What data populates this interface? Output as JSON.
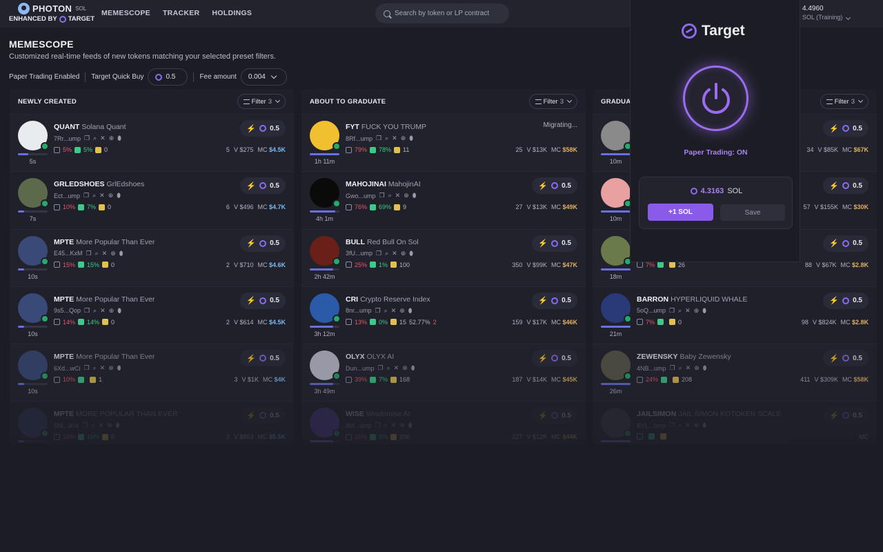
{
  "brand": {
    "name": "PHOTON",
    "chain": "SOL",
    "enhanced": "ENHANCED BY",
    "partner": "TARGET"
  },
  "nav": {
    "memescope": "MEMESCOPE",
    "tracker": "TRACKER",
    "holdings": "HOLDINGS"
  },
  "search": {
    "placeholder": "Search by token or LP contract"
  },
  "account": {
    "balance": "4.4960",
    "label": "SOL (Training)"
  },
  "page": {
    "title": "MEMESCOPE",
    "subtitle": "Customized real-time feeds of new tokens matching your selected preset filters."
  },
  "options": {
    "paper": "Paper Trading Enabled",
    "quickbuy_label": "Target Quick Buy",
    "quickbuy_value": "0.5",
    "fee_label": "Fee amount",
    "fee_value": "0.004"
  },
  "colors": {
    "accent": "#8b6cf0",
    "red": "#e05a6a",
    "green": "#3ec98a",
    "yellow": "#e0c050"
  },
  "columns": [
    {
      "title": "NEWLY CREATED",
      "filter": "Filter",
      "filter_count": "3",
      "cards": [
        {
          "ticker": "QUANT",
          "name": "Solana Quant",
          "addr": "7Rr...ump",
          "age": "5s",
          "s1": "5%",
          "s2": "5%",
          "s3": "0",
          "holders": "5",
          "vol": "V $275",
          "mc": "$4.5K",
          "buy": "0.5",
          "progress": 0.35,
          "av": "#e8ecef"
        },
        {
          "ticker": "GRLEDSHOES",
          "name": "GrlEdshoes",
          "addr": "Ect...ump",
          "age": "7s",
          "s1": "10%",
          "s2": "7%",
          "s3": "0",
          "holders": "6",
          "vol": "V $496",
          "mc": "$4.7K",
          "buy": "0.5",
          "progress": 0.2,
          "av": "#5a6a4a"
        },
        {
          "ticker": "MPTE",
          "name": "More Popular Than Ever",
          "addr": "E45...KxM",
          "age": "10s",
          "s1": "15%",
          "s2": "15%",
          "s3": "0",
          "holders": "2",
          "vol": "V $710",
          "mc": "$4.6K",
          "buy": "0.5",
          "progress": 0.2,
          "av": "#3a4a78"
        },
        {
          "ticker": "MPTE",
          "name": "More Popular Than Ever",
          "addr": "9s5...Qop",
          "age": "10s",
          "s1": "14%",
          "s2": "14%",
          "s3": "0",
          "holders": "2",
          "vol": "V $614",
          "mc": "$4.5K",
          "buy": "0.5",
          "progress": 0.2,
          "av": "#3a4a78"
        },
        {
          "ticker": "MPTE",
          "name": "More Popular Than Ever",
          "addr": "6Xd...wCi",
          "age": "10s",
          "s1": "10%",
          "s2": "",
          "s3": "1",
          "holders": "3",
          "vol": "V $1K",
          "mc": "$4K",
          "buy": "0.5",
          "progress": 0.2,
          "av": "#3a4a78"
        },
        {
          "ticker": "MPTE",
          "name": "MORE POPULAR THAN EVER",
          "addr": "5Ni...iKrk",
          "age": "",
          "s1": "16%",
          "s2": "16%",
          "s3": "0",
          "holders": "2",
          "vol": "V $863",
          "mc": "$5.5K",
          "buy": "0.5",
          "progress": 0.2,
          "av": "#3a4a78"
        }
      ]
    },
    {
      "title": "ABOUT TO GRADUATE",
      "filter": "Filter",
      "filter_count": "3",
      "cards": [
        {
          "ticker": "FYT",
          "name": "FUCK YOU TRUMP",
          "addr": "8Rf...ump",
          "age": "1h 11m",
          "s1": "79%",
          "s2": "78%",
          "s3": "11",
          "holders": "25",
          "vol": "V $13K",
          "mc": "$58K",
          "buy": "",
          "status": "Migrating...",
          "progress": 1,
          "av": "#f0c030"
        },
        {
          "ticker": "MAHOJINAI",
          "name": "MahojinAI",
          "addr": "Gwo...ump",
          "age": "4h 1m",
          "s1": "76%",
          "s2": "69%",
          "s3": "9",
          "holders": "27",
          "vol": "V $13K",
          "mc": "$49K",
          "buy": "0.5",
          "progress": 0.85,
          "av": "#0a0a0a"
        },
        {
          "ticker": "BULL",
          "name": "Red Bull On Sol",
          "addr": "3fU...ump",
          "age": "2h 42m",
          "s1": "25%",
          "s2": "1%",
          "s3": "100",
          "holders": "350",
          "vol": "V $99K",
          "mc": "$47K",
          "buy": "0.5",
          "progress": 0.8,
          "av": "#6a2018"
        },
        {
          "ticker": "CRI",
          "name": "Crypto Reserve Index",
          "addr": "8nr...ump",
          "age": "3h 12m",
          "s1": "13%",
          "s2": "0%",
          "s3": "15",
          "extra1": "52.77%",
          "extra2": "2",
          "holders": "159",
          "vol": "V $17K",
          "mc": "$46K",
          "buy": "0.5",
          "progress": 0.8,
          "av": "#2a5aa8"
        },
        {
          "ticker": "OLYX",
          "name": "OLYX AI",
          "addr": "Dun...ump",
          "age": "3h 49m",
          "s1": "39%",
          "s2": "7%",
          "s3": "168",
          "holders": "187",
          "vol": "V $14K",
          "mc": "$45K",
          "buy": "0.5",
          "progress": 0.8,
          "av": "#c8c8d8"
        },
        {
          "ticker": "WISE",
          "name": "Wisdomise AI",
          "addr": "8bf...ump",
          "age": "",
          "s1": "26%",
          "s2": "5%",
          "s3": "206",
          "holders": "227",
          "vol": "V $12K",
          "mc": "$44K",
          "buy": "0.5",
          "progress": 0.8,
          "av": "#6a4ac8"
        }
      ]
    },
    {
      "title": "GRADUATED",
      "filter": "Filter",
      "filter_count": "3",
      "cards": [
        {
          "ticker": "",
          "name": "",
          "addr": "",
          "age": "10m",
          "s1": "",
          "s2": "",
          "s3": "",
          "holders": "34",
          "vol": "V $85K",
          "mc": "$67K",
          "buy": "0.5",
          "progress": 1,
          "av": "#8a8a8a"
        },
        {
          "ticker": "",
          "name": "",
          "addr": "",
          "age": "10m",
          "s1": "",
          "s2": "",
          "s3": "",
          "holders": "57",
          "vol": "V $155K",
          "mc": "$30K",
          "buy": "0.5",
          "progress": 1,
          "av": "#e8a0a0"
        },
        {
          "ticker": "",
          "name": "",
          "addr": "",
          "age": "18m",
          "s1": "7%",
          "s2": "",
          "s3": "26",
          "holders": "88",
          "vol": "V $67K",
          "mc": "$2.8K",
          "buy": "0.5",
          "progress": 1,
          "av": "#6a7a4a"
        },
        {
          "ticker": "BARRON",
          "name": "HYPERLIQUID WHALE",
          "addr": "5oQ...ump",
          "age": "21m",
          "s1": "7%",
          "s2": "",
          "s3": "0",
          "holders": "98",
          "vol": "V $824K",
          "mc": "$2.8K",
          "buy": "0.5",
          "progress": 1,
          "av": "#2a3a78"
        },
        {
          "ticker": "ZEWENSKY",
          "name": "Baby Zewensky",
          "addr": "4NB...ump",
          "age": "26m",
          "s1": "24%",
          "s2": "",
          "s3": "208",
          "holders": "411",
          "vol": "V $309K",
          "mc": "$58K",
          "buy": "0.5",
          "progress": 1,
          "av": "#5a5a4a"
        },
        {
          "ticker": "JAILSIMON",
          "name": "JAIL SIMON KOTOKEN SCALE",
          "addr": "BYL...ump",
          "age": "",
          "s1": "",
          "s2": "",
          "s3": "",
          "holders": "",
          "vol": "",
          "mc": "",
          "buy": "0.5",
          "progress": 1,
          "av": "#4a4a4a"
        }
      ]
    }
  ],
  "popup": {
    "title": "Target",
    "status": "Paper Trading: ON",
    "balance": "4.3163",
    "unit": "SOL",
    "add_label": "+1 SOL",
    "save_label": "Save"
  }
}
